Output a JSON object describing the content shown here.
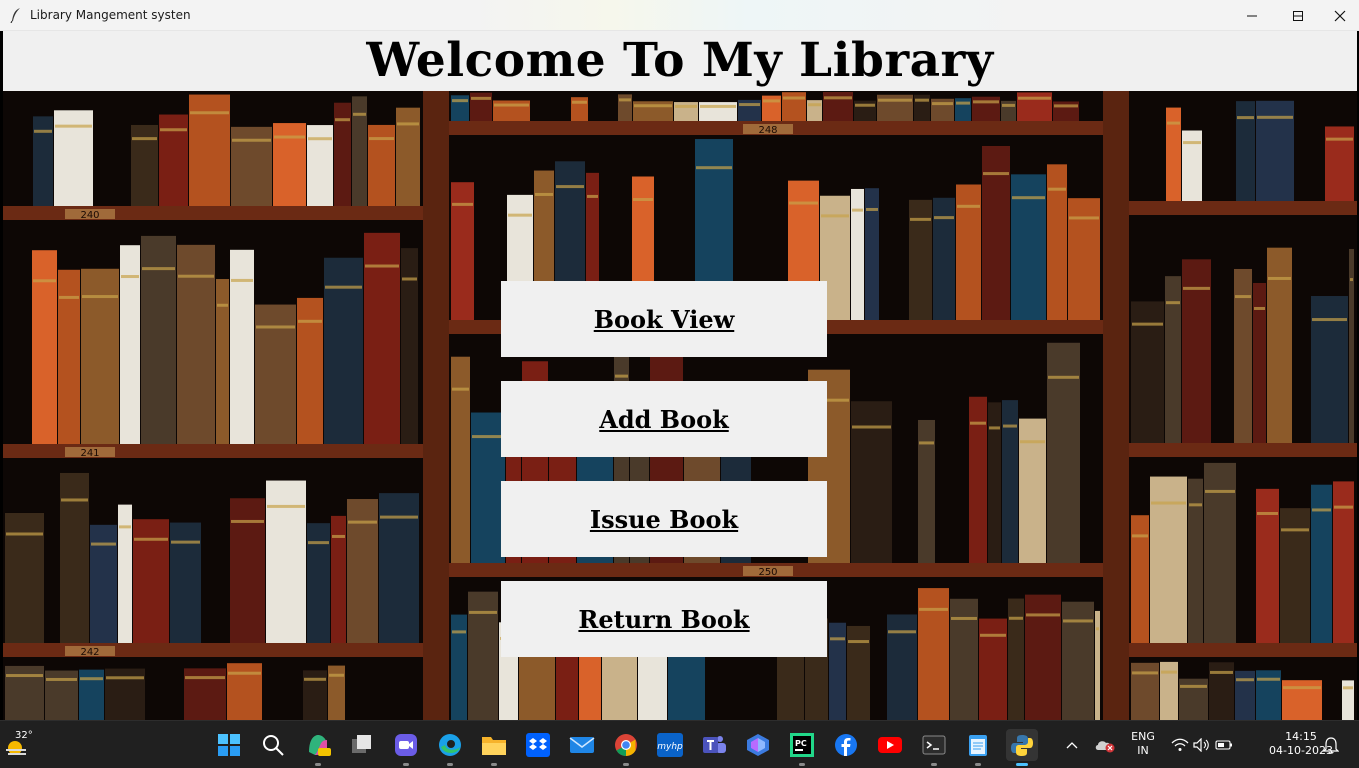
{
  "window": {
    "title": "Library Mangement systen",
    "icon": "feather-icon"
  },
  "header": {
    "title": "Welcome To My Library"
  },
  "shelf_labels": [
    "240",
    "248",
    "241",
    "250",
    "242"
  ],
  "menu": {
    "buttons": [
      {
        "label": "Book View"
      },
      {
        "label": "Add Book"
      },
      {
        "label": "Issue Book"
      },
      {
        "label": "Return Book"
      }
    ]
  },
  "taskbar": {
    "weather": {
      "temp": "32°",
      "icon": "sun-haze-icon"
    },
    "apps": [
      "start-icon",
      "search-icon",
      "copilot-icon",
      "task-view-icon",
      "zoom-icon",
      "edge-icon",
      "file-explorer-icon",
      "dropbox-icon",
      "mail-icon",
      "chrome-icon",
      "myhp-icon",
      "teams-icon",
      "app-icon",
      "pycharm-icon",
      "facebook-icon",
      "youtube-icon",
      "terminal-icon",
      "notepad-icon",
      "python-icon"
    ],
    "myhp_label": "myhp",
    "language": {
      "line1": "ENG",
      "line2": "IN"
    },
    "clock": {
      "time": "14:15",
      "date": "04-10-2023"
    }
  },
  "colors": {
    "button_bg": "#f0f0f0",
    "header_bg": "#f0f0f0",
    "taskbar_bg": "#202020",
    "shelf_wood": "#6b2a14"
  }
}
